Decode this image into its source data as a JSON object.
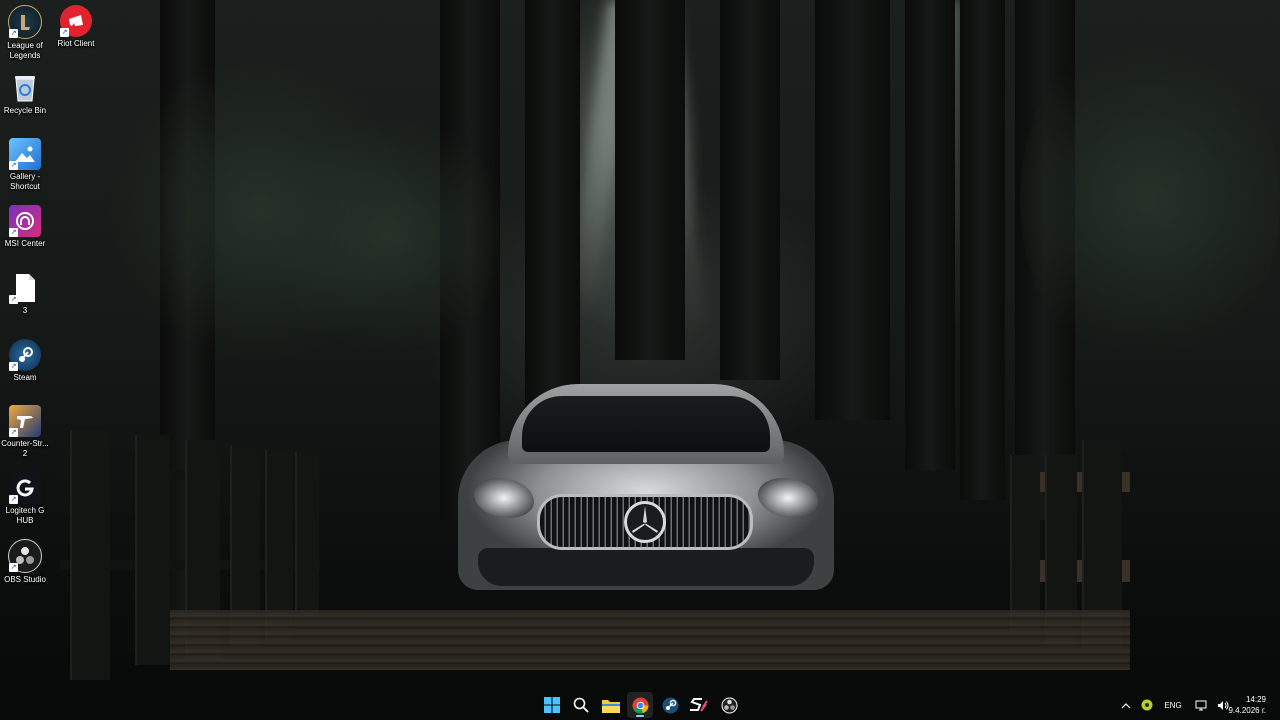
{
  "desktop": {
    "icons": [
      {
        "label": "League of Legends",
        "icon": "league-of-legends-icon"
      },
      {
        "label": "Riot Client",
        "icon": "riot-client-icon"
      },
      {
        "label": "Recycle Bin",
        "icon": "recycle-bin-icon"
      },
      {
        "label": "Gallery - Shortcut",
        "icon": "gallery-icon"
      },
      {
        "label": "MSI Center",
        "icon": "msi-center-icon"
      },
      {
        "label": "3",
        "icon": "file-icon"
      },
      {
        "label": "Steam",
        "icon": "steam-icon"
      },
      {
        "label": "Counter-Str... 2",
        "icon": "counter-strike-icon"
      },
      {
        "label": "Logitech G HUB",
        "icon": "logitech-g-hub-icon"
      },
      {
        "label": "OBS Studio",
        "icon": "obs-studio-icon"
      }
    ]
  },
  "taskbar": {
    "pinned": [
      {
        "name": "start",
        "icon": "windows-start-icon"
      },
      {
        "name": "search",
        "icon": "search-icon"
      },
      {
        "name": "file-explorer",
        "icon": "folder-icon"
      },
      {
        "name": "chrome",
        "icon": "chrome-icon",
        "active": true
      },
      {
        "name": "steam",
        "icon": "steam-icon"
      },
      {
        "name": "s-app",
        "icon": "s-logo-icon"
      },
      {
        "name": "obs",
        "icon": "obs-icon"
      }
    ],
    "tray": {
      "language": "ENG",
      "time": "14:29",
      "date": "9.4.2026 г."
    }
  },
  "colors": {
    "accent": "#9ac6ff",
    "riot_red": "#e0232e",
    "taskbar_bg": "#0a0c0c"
  }
}
